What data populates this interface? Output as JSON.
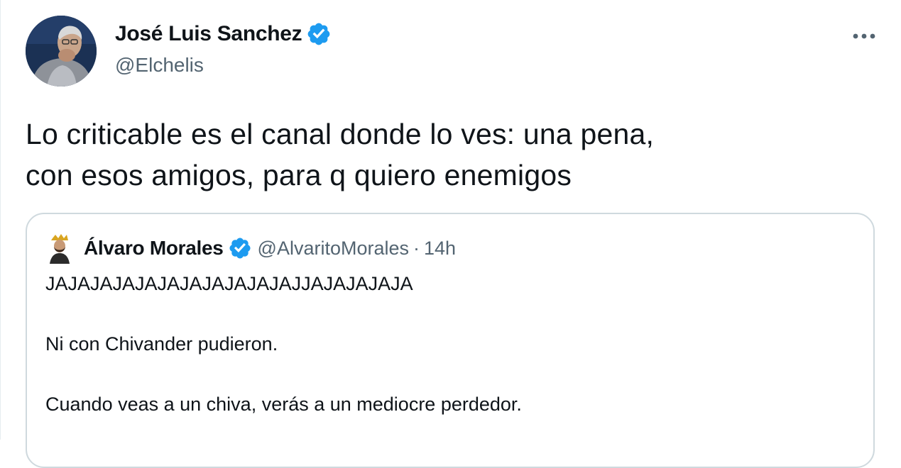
{
  "tweet": {
    "author_name": "José Luis Sanchez",
    "author_handle": "@Elchelis",
    "text_lines": [
      "Lo criticable es el canal donde lo ves: una pena,",
      "con esos amigos, para q quiero enemigos"
    ],
    "more_icon": "more-horizontal-icon",
    "verified_icon": "verified-badge-icon"
  },
  "quote": {
    "author_name": "Álvaro Morales",
    "author_handle": "@AlvaritoMorales",
    "separator": "·",
    "time": "14h",
    "paragraphs": [
      "JAJAJAJAJAJAJAJAJAJAJAJJAJAJAJAJA",
      "Ni con Chivander pudieron.",
      "Cuando veas a un chiva, verás a un mediocre perdedor."
    ]
  },
  "colors": {
    "text_primary": "#0f1419",
    "text_secondary": "#536471",
    "verified_blue": "#1d9bf0",
    "border": "#cfd9de"
  }
}
